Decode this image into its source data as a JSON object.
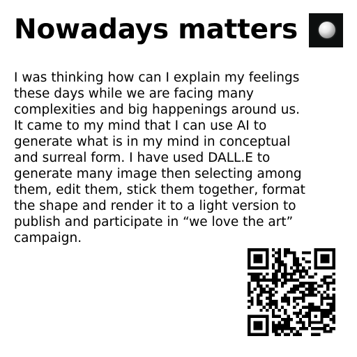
{
  "title": "Nowadays matters",
  "body": "I was thinking how can I explain my feelings these days while we are facing many complexities and big happenings around us. It came to my mind that I can use AI to generate what is in my mind in conceptual and surreal form. I have used DALL.E to generate many image then selecting among them, edit them, stick them together, format the shape and render it to a light version to publish and participate in “we love the art” campaign.",
  "thumbnail": {
    "icon": "sphere-icon",
    "background": "#0d0f0f"
  },
  "qr_code": {
    "icon": "qr-code-icon",
    "color": "#000000"
  }
}
